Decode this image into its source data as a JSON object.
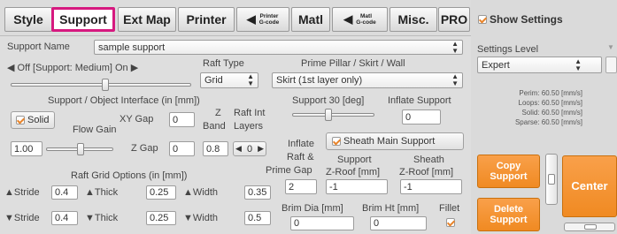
{
  "tabs": [
    {
      "label": "Style"
    },
    {
      "label": "Support"
    },
    {
      "label": "Ext Map"
    },
    {
      "label": "Printer"
    },
    {
      "line1": "Printer",
      "line2": "G-code"
    },
    {
      "label": "Matl"
    },
    {
      "line1": "Matl",
      "line2": "G-code"
    },
    {
      "label": "Misc."
    },
    {
      "label": "PRO"
    }
  ],
  "show_settings": {
    "label": "Show Settings",
    "checked": true
  },
  "support_name": {
    "label": "Support Name",
    "value": "sample support"
  },
  "support_toggle": {
    "left_arrow": "◀",
    "text": "Off [Support: Medium] On",
    "right_arrow": "▶"
  },
  "raft_type": {
    "label": "Raft Type",
    "value": "Grid"
  },
  "prime_pillar": {
    "label": "Prime Pillar / Skirt /  Wall",
    "value": "Skirt (1st layer only)"
  },
  "interface": {
    "label": "Support / Object Interface (in [mm])"
  },
  "solid": {
    "label": "Solid",
    "checked": true
  },
  "flow_gain": {
    "label": "Flow Gain",
    "value": "1.00"
  },
  "xy_gap": {
    "label": "XY Gap",
    "value": "0"
  },
  "z_gap": {
    "label": "Z Gap",
    "value": "0"
  },
  "z_band": {
    "label1": "Z",
    "label2": "Band",
    "value": "0.8"
  },
  "raft_int_layers": {
    "label1": "Raft Int",
    "label2": "Layers",
    "value": "0"
  },
  "support_angle": {
    "label": "Support 30 [deg]"
  },
  "inflate_support": {
    "label": "Inflate Support",
    "value": "0"
  },
  "inflate_raft": {
    "label1": "Inflate",
    "label2": "Raft &",
    "label3": "Prime Gap",
    "value": "2"
  },
  "sheath_main_support": {
    "label": "Sheath Main Support",
    "checked": true
  },
  "support_z_roof": {
    "label1": "Support",
    "label2": "Z-Roof [mm]",
    "value": "-1"
  },
  "sheath_z_roof": {
    "label1": "Sheath",
    "label2": "Z-Roof [mm]",
    "value": "-1"
  },
  "raft_grid": {
    "label": "Raft Grid Options (in [mm])"
  },
  "stride_up": {
    "label": "Stride",
    "value": "0.4"
  },
  "thick_up": {
    "label": "Thick",
    "value": "0.25"
  },
  "width_up": {
    "label": "Width",
    "value": "0.35"
  },
  "stride_down": {
    "label": "Stride",
    "value": "0.4"
  },
  "thick_down": {
    "label": "Thick",
    "value": "0.25"
  },
  "width_down": {
    "label": "Width",
    "value": "0.5"
  },
  "brim_dia": {
    "label": "Brim Dia [mm]",
    "value": "0"
  },
  "brim_ht": {
    "label": "Brim Ht [mm]",
    "value": "0"
  },
  "fillet": {
    "label": "Fillet",
    "checked": true
  },
  "settings_level": {
    "label": "Settings Level",
    "value": "Expert"
  },
  "speeds": {
    "perim": "Perim: 60.50 [mm/s]",
    "loops": "Loops: 60.50 [mm/s]",
    "solid": "Solid: 60.50 [mm/s]",
    "sparse": "Sparse: 60.50 [mm/s]"
  },
  "copy_support": {
    "line1": "Copy",
    "line2": "Support"
  },
  "delete_support": {
    "line1": "Delete",
    "line2": "Support"
  },
  "center": {
    "label": "Center"
  },
  "colors": {
    "accent_orange": "#f08a22",
    "active_tab_border": "#d6197f"
  }
}
